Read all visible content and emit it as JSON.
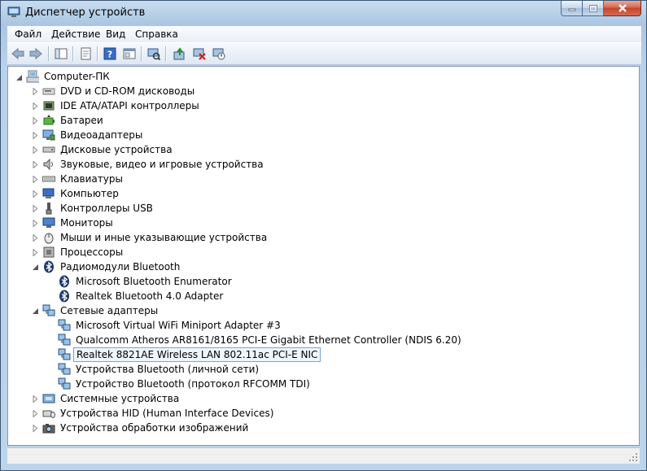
{
  "window": {
    "title": "Диспетчер устройств"
  },
  "menu": [
    "Файл",
    "Действие",
    "Вид",
    "Справка"
  ],
  "toolbar": {
    "buttons": [
      "back-icon",
      "forward-icon",
      "show-hide-tree-icon",
      "properties-icon",
      "help-icon",
      "view-icon",
      "scan-hardware-icon",
      "update-driver-icon",
      "uninstall-icon",
      "disable-icon"
    ]
  },
  "tree": {
    "root": "Computer-ПК",
    "categories": [
      {
        "label": "DVD и CD-ROM дисководы",
        "icon": "dvd-drive-icon",
        "expanded": false
      },
      {
        "label": "IDE ATA/ATAPI контроллеры",
        "icon": "ide-controller-icon",
        "expanded": false
      },
      {
        "label": "Батареи",
        "icon": "battery-icon",
        "expanded": false
      },
      {
        "label": "Видеоадаптеры",
        "icon": "display-adapter-icon",
        "expanded": false
      },
      {
        "label": "Дисковые устройства",
        "icon": "disk-drive-icon",
        "expanded": false
      },
      {
        "label": "Звуковые, видео и игровые устройства",
        "icon": "sound-icon",
        "expanded": false
      },
      {
        "label": "Клавиатуры",
        "icon": "keyboard-icon",
        "expanded": false
      },
      {
        "label": "Компьютер",
        "icon": "computer-icon",
        "expanded": false
      },
      {
        "label": "Контроллеры USB",
        "icon": "usb-icon",
        "expanded": false
      },
      {
        "label": "Мониторы",
        "icon": "monitor-icon",
        "expanded": false
      },
      {
        "label": "Мыши и иные указывающие устройства",
        "icon": "mouse-icon",
        "expanded": false
      },
      {
        "label": "Процессоры",
        "icon": "processor-icon",
        "expanded": false
      },
      {
        "label": "Радиомодули Bluetooth",
        "icon": "bluetooth-icon",
        "expanded": true,
        "children": [
          {
            "label": "Microsoft Bluetooth Enumerator",
            "icon": "bluetooth-icon"
          },
          {
            "label": "Realtek Bluetooth 4.0 Adapter",
            "icon": "bluetooth-icon"
          }
        ]
      },
      {
        "label": "Сетевые адаптеры",
        "icon": "network-adapter-icon",
        "expanded": true,
        "children": [
          {
            "label": "Microsoft Virtual WiFi Miniport Adapter #3",
            "icon": "network-adapter-icon"
          },
          {
            "label": "Qualcomm Atheros AR8161/8165 PCI-E Gigabit Ethernet Controller (NDIS 6.20)",
            "icon": "network-adapter-icon"
          },
          {
            "label": "Realtek 8821AE Wireless LAN 802.11ac PCI-E NIC",
            "icon": "network-adapter-icon",
            "selected": true
          },
          {
            "label": "Устройства Bluetooth (личной сети)",
            "icon": "network-adapter-icon"
          },
          {
            "label": "Устройство Bluetooth (протокол RFCOMM TDI)",
            "icon": "network-adapter-icon"
          }
        ]
      },
      {
        "label": "Системные устройства",
        "icon": "system-device-icon",
        "expanded": false
      },
      {
        "label": "Устройства HID (Human Interface Devices)",
        "icon": "hid-icon",
        "expanded": false
      },
      {
        "label": "Устройства обработки изображений",
        "icon": "imaging-device-icon",
        "expanded": false
      }
    ]
  },
  "colors": {
    "selection_border": "#7da2ce",
    "selection_fill": "#eef5fd",
    "close_button": "#c3452a"
  }
}
